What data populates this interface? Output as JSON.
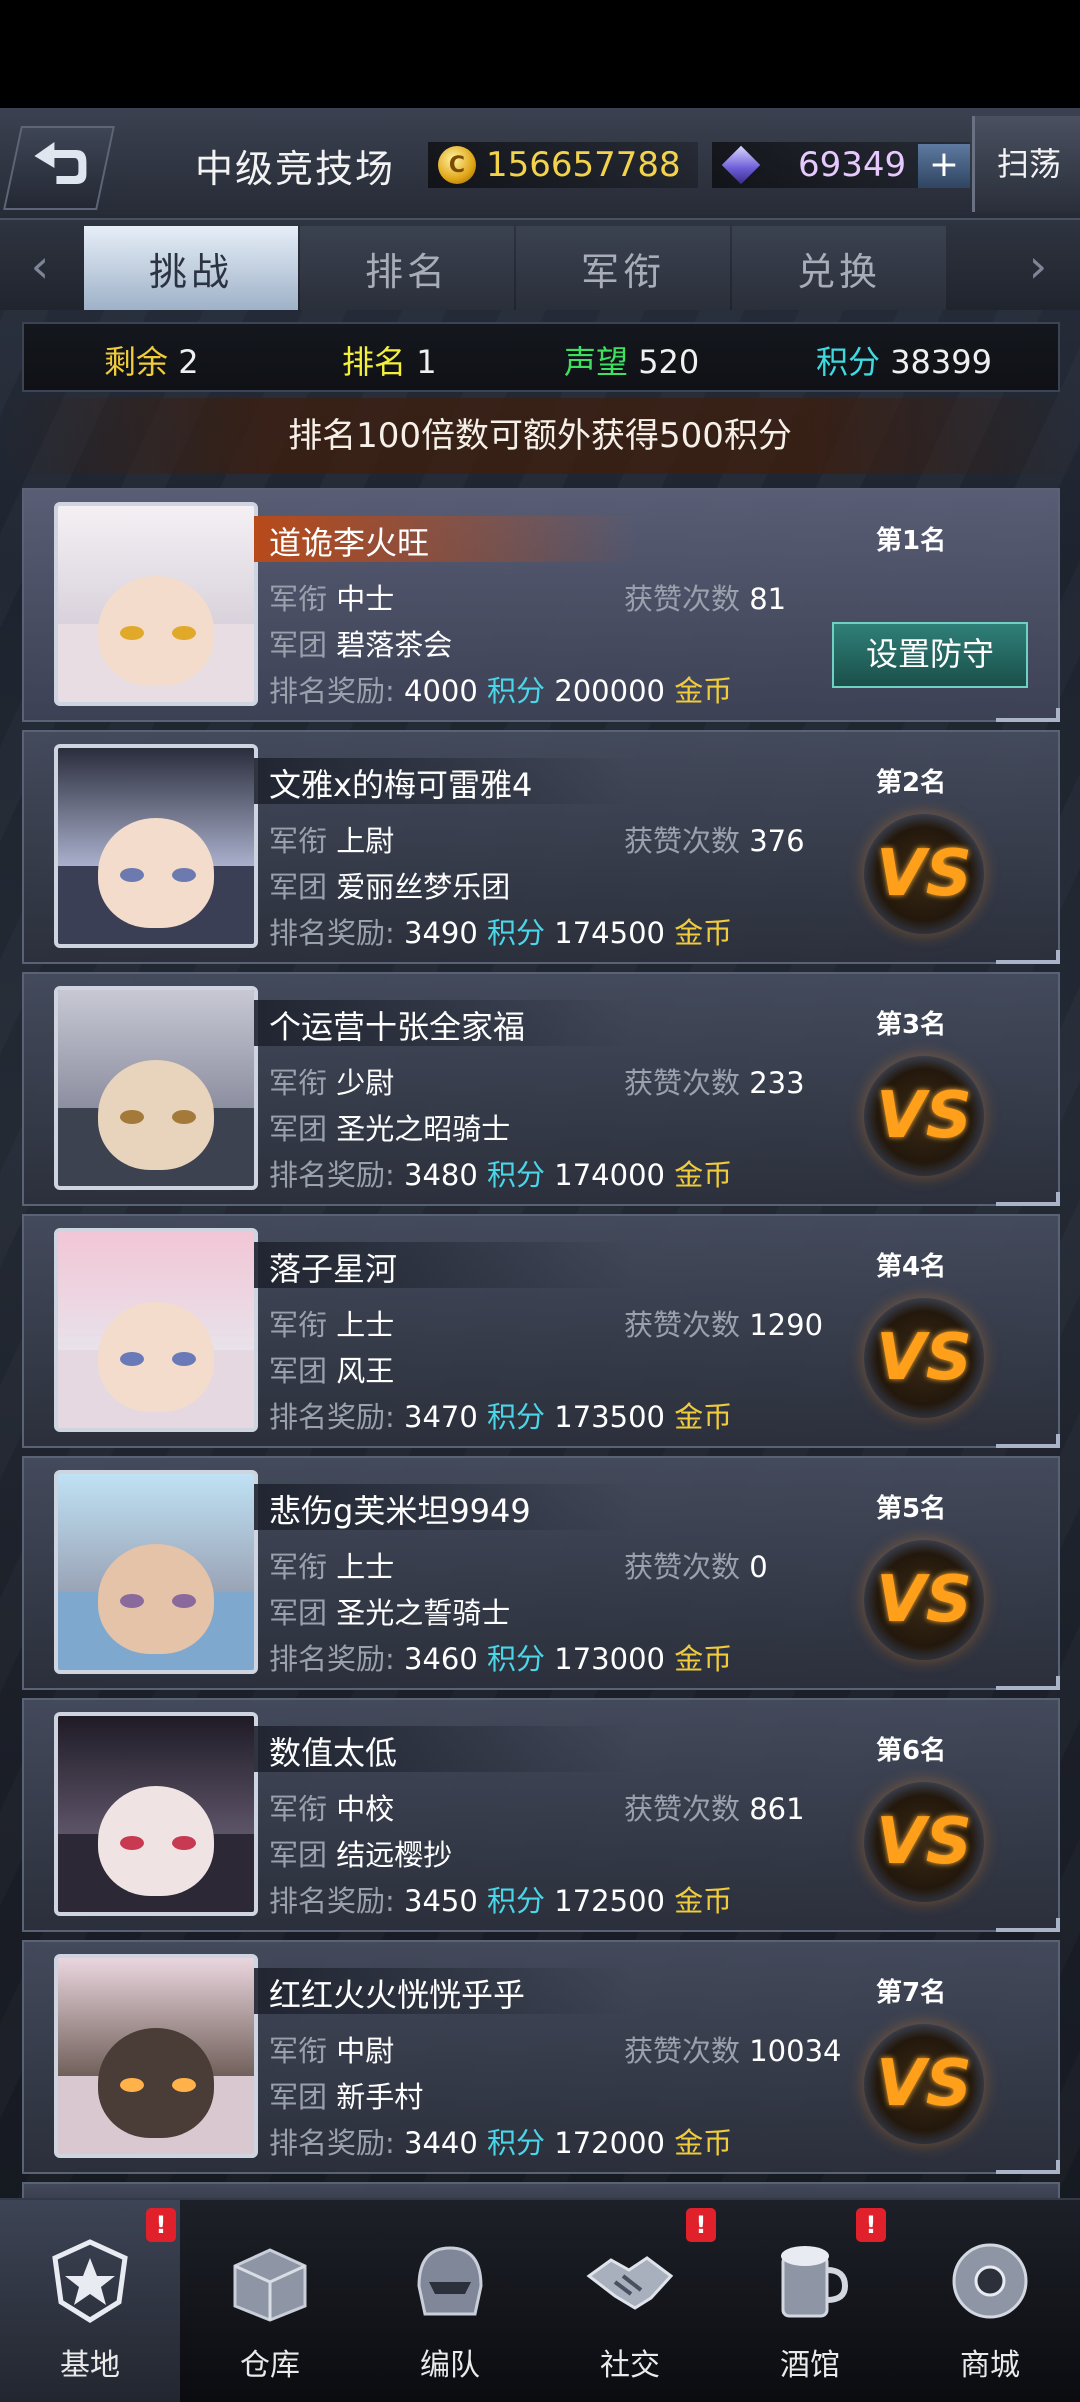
{
  "header": {
    "title": "中级竞技场",
    "gold": "156657788",
    "gold_icon": "C",
    "gems": "69349",
    "plus": "+",
    "sweep": "扫荡"
  },
  "tabs": [
    {
      "label": "挑战",
      "active": true
    },
    {
      "label": "排名",
      "active": false
    },
    {
      "label": "军衔",
      "active": false
    },
    {
      "label": "兑换",
      "active": false
    }
  ],
  "stats": {
    "remaining_label": "剩余",
    "remaining": "2",
    "rank_label": "排名",
    "rank": "1",
    "prestige_label": "声望",
    "prestige": "520",
    "points_label": "积分",
    "points": "38399"
  },
  "notice": "排名100倍数可额外获得500积分",
  "labels": {
    "rank_title": "军衔",
    "legion": "军团",
    "likes": "获赞次数",
    "reward": "排名奖励:",
    "points_unit": "积分",
    "gold_unit": "金币",
    "defend_button": "设置防守",
    "vs": "VS"
  },
  "players": [
    {
      "name": "道诡李火旺",
      "rank": "第1名",
      "title": "中士",
      "legion": "碧落茶会",
      "likes": "81",
      "points": "4000",
      "gold": "200000",
      "self": true
    },
    {
      "name": "文雅x的梅可雷雅4",
      "rank": "第2名",
      "title": "上尉",
      "legion": "爱丽丝梦乐团",
      "likes": "376",
      "points": "3490",
      "gold": "174500"
    },
    {
      "name": "个运营十张全家福",
      "rank": "第3名",
      "title": "少尉",
      "legion": "圣光之昭骑士",
      "likes": "233",
      "points": "3480",
      "gold": "174000"
    },
    {
      "name": "落子星河",
      "rank": "第4名",
      "title": "上士",
      "legion": "风王",
      "likes": "1290",
      "points": "3470",
      "gold": "173500"
    },
    {
      "name": "悲伤g芙米坦9949",
      "rank": "第5名",
      "title": "上士",
      "legion": "圣光之誓骑士",
      "likes": "0",
      "points": "3460",
      "gold": "173000"
    },
    {
      "name": "数值太低",
      "rank": "第6名",
      "title": "中校",
      "legion": "结远樱抄",
      "likes": "861",
      "points": "3450",
      "gold": "172500"
    },
    {
      "name": "红红火火恍恍乎乎",
      "rank": "第7名",
      "title": "中尉",
      "legion": "新手村",
      "likes": "10034",
      "points": "3440",
      "gold": "172000"
    }
  ],
  "nav": [
    {
      "label": "基地",
      "icon": "base-star-icon",
      "badge": "!",
      "active": true
    },
    {
      "label": "仓库",
      "icon": "warehouse-box-icon",
      "badge": "",
      "active": false
    },
    {
      "label": "编队",
      "icon": "squad-helmet-icon",
      "badge": "",
      "active": false
    },
    {
      "label": "社交",
      "icon": "handshake-icon",
      "badge": "!",
      "active": false
    },
    {
      "label": "酒馆",
      "icon": "tavern-mug-icon",
      "badge": "!",
      "active": false
    },
    {
      "label": "商城",
      "icon": "shop-robot-icon",
      "badge": "",
      "active": false
    }
  ]
}
